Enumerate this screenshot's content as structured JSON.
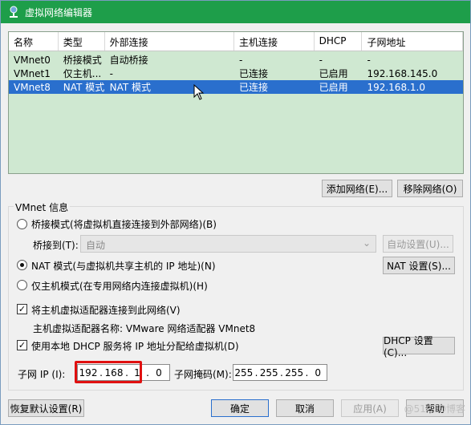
{
  "window": {
    "title": "虚拟网络编辑器"
  },
  "table": {
    "headers": [
      "名称",
      "类型",
      "外部连接",
      "主机连接",
      "DHCP",
      "子网地址"
    ],
    "rows": [
      [
        "VMnet0",
        "桥接模式",
        "自动桥接",
        "-",
        "-",
        "-"
      ],
      [
        "VMnet1",
        "仅主机...",
        "-",
        "已连接",
        "已启用",
        "192.168.145.0"
      ],
      [
        "VMnet8",
        "NAT 模式",
        "NAT 模式",
        "已连接",
        "已启用",
        "192.168.1.0"
      ]
    ],
    "selected_row": 2
  },
  "buttons": {
    "add_network": "添加网络(E)...",
    "remove_network": "移除网络(O)",
    "auto_settings": "自动设置(U)...",
    "nat_settings": "NAT 设置(S)...",
    "dhcp_settings": "DHCP 设置(C)...",
    "restore_defaults": "恢复默认设置(R)",
    "ok": "确定",
    "cancel": "取消",
    "apply": "应用(A)",
    "help": "帮助"
  },
  "vmnet_info": {
    "label": "VMnet 信息",
    "bridged_mode": "桥接模式(将虚拟机直接连接到外部网络)(B)",
    "bridged_to_label": "桥接到(T):",
    "bridged_to_value": "自动",
    "nat_mode": "NAT 模式(与虚拟机共享主机的 IP 地址)(N)",
    "host_only_mode": "仅主机模式(在专用网络内连接虚拟机)(H)",
    "connect_adapter": "将主机虚拟适配器连接到此网络(V)",
    "adapter_name": "主机虚拟适配器名称: VMware 网络适配器 VMnet8",
    "use_dhcp": "使用本地 DHCP 服务将 IP 地址分配给虚拟机(D)",
    "subnet_ip_label": "子网 IP (I):",
    "subnet_ip": [
      "192",
      "168",
      "1",
      "0"
    ],
    "subnet_mask_label": "子网掩码(M):",
    "subnet_mask": [
      "255",
      "255",
      "255",
      "0"
    ]
  },
  "watermark": "@51CTO博客",
  "colors": {
    "titlebar": "#1e9e4a",
    "list_bg": "#cfe8d1",
    "selected": "#2a6fcd",
    "highlight": "#e01010"
  }
}
